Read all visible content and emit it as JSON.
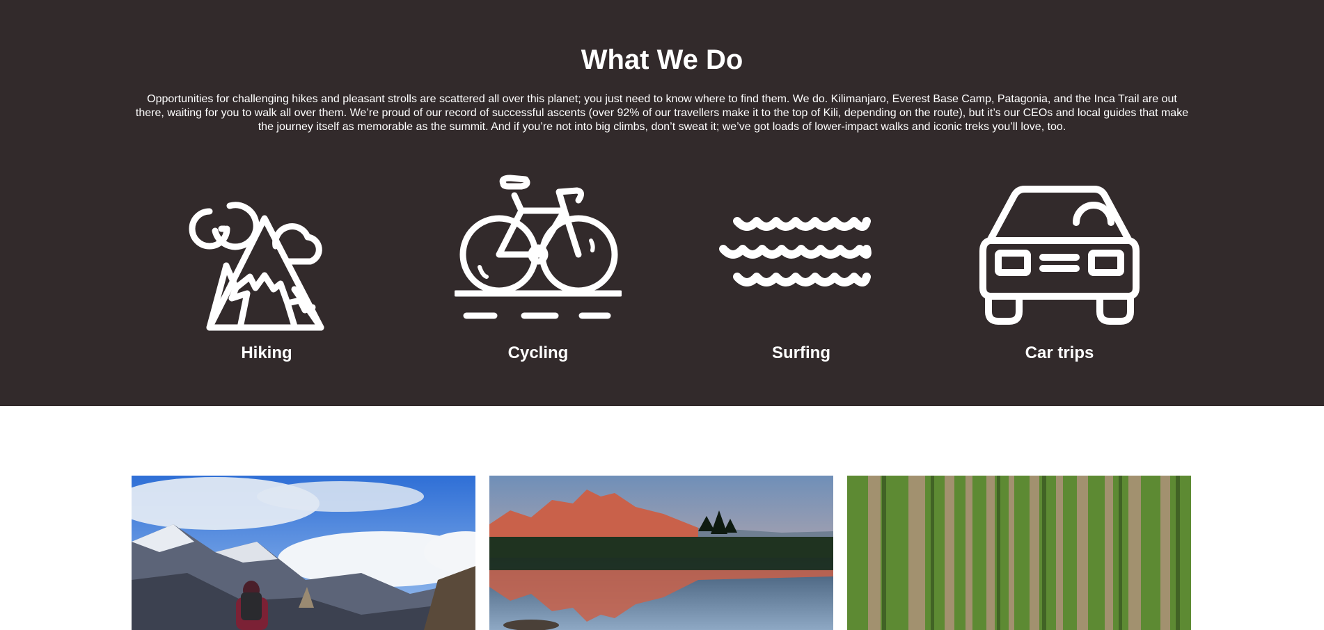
{
  "what_we_do": {
    "title": "What We Do",
    "description": "Opportunities for challenging hikes and pleasant strolls are scattered all over this planet; you just need to know where to find them. We do. Kilimanjaro, Everest Base Camp, Patagonia, and the Inca Trail are out there, waiting for you to walk all over them. We’re proud of our record of successful ascents (over 92% of our travellers make it to the top of Kili, depending on the route), but it’s our CEOs and local guides that make the journey itself as memorable as the summit. And if you’re not into big climbs, don’t sweat it; we’ve got loads of lower-impact walks and iconic treks you’ll love, too.",
    "activities": [
      {
        "label": "Hiking",
        "icon": "mountain-icon"
      },
      {
        "label": "Cycling",
        "icon": "bicycle-icon"
      },
      {
        "label": "Surfing",
        "icon": "waves-icon"
      },
      {
        "label": "Car trips",
        "icon": "car-icon"
      }
    ]
  },
  "gallery": {
    "photos": [
      {
        "subject": "hiker-mountains-photo"
      },
      {
        "subject": "mountain-lake-reflection-photo"
      },
      {
        "subject": "forest-trees-photo"
      }
    ]
  },
  "colors": {
    "section_background": "#322a2b",
    "text": "#ffffff"
  }
}
